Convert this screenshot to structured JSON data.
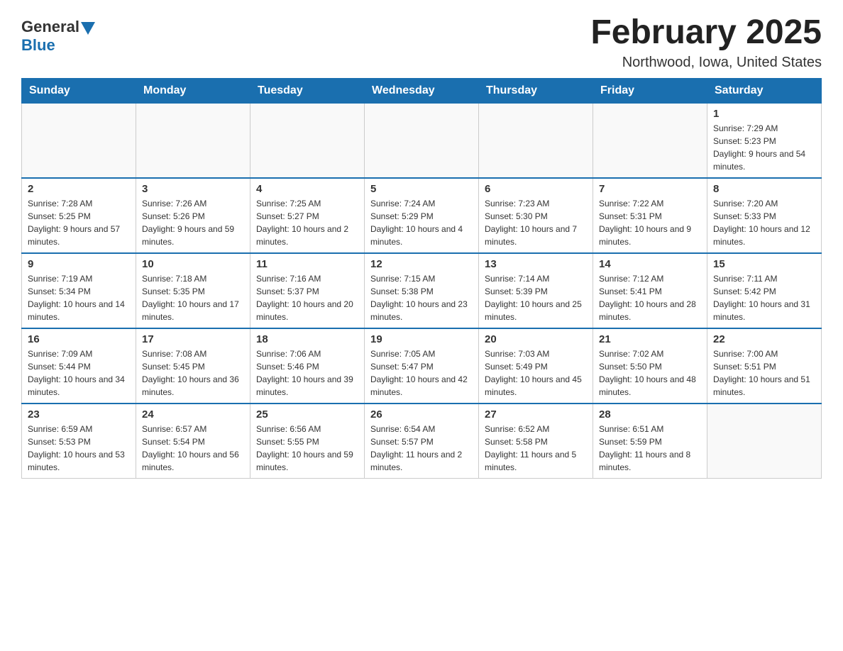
{
  "header": {
    "logo": {
      "text_general": "General",
      "text_blue": "Blue",
      "arrow_icon": "triangle-down-icon"
    },
    "title": "February 2025",
    "location": "Northwood, Iowa, United States"
  },
  "weekdays": [
    "Sunday",
    "Monday",
    "Tuesday",
    "Wednesday",
    "Thursday",
    "Friday",
    "Saturday"
  ],
  "weeks": [
    [
      {
        "day": "",
        "info": ""
      },
      {
        "day": "",
        "info": ""
      },
      {
        "day": "",
        "info": ""
      },
      {
        "day": "",
        "info": ""
      },
      {
        "day": "",
        "info": ""
      },
      {
        "day": "",
        "info": ""
      },
      {
        "day": "1",
        "info": "Sunrise: 7:29 AM\nSunset: 5:23 PM\nDaylight: 9 hours and 54 minutes."
      }
    ],
    [
      {
        "day": "2",
        "info": "Sunrise: 7:28 AM\nSunset: 5:25 PM\nDaylight: 9 hours and 57 minutes."
      },
      {
        "day": "3",
        "info": "Sunrise: 7:26 AM\nSunset: 5:26 PM\nDaylight: 9 hours and 59 minutes."
      },
      {
        "day": "4",
        "info": "Sunrise: 7:25 AM\nSunset: 5:27 PM\nDaylight: 10 hours and 2 minutes."
      },
      {
        "day": "5",
        "info": "Sunrise: 7:24 AM\nSunset: 5:29 PM\nDaylight: 10 hours and 4 minutes."
      },
      {
        "day": "6",
        "info": "Sunrise: 7:23 AM\nSunset: 5:30 PM\nDaylight: 10 hours and 7 minutes."
      },
      {
        "day": "7",
        "info": "Sunrise: 7:22 AM\nSunset: 5:31 PM\nDaylight: 10 hours and 9 minutes."
      },
      {
        "day": "8",
        "info": "Sunrise: 7:20 AM\nSunset: 5:33 PM\nDaylight: 10 hours and 12 minutes."
      }
    ],
    [
      {
        "day": "9",
        "info": "Sunrise: 7:19 AM\nSunset: 5:34 PM\nDaylight: 10 hours and 14 minutes."
      },
      {
        "day": "10",
        "info": "Sunrise: 7:18 AM\nSunset: 5:35 PM\nDaylight: 10 hours and 17 minutes."
      },
      {
        "day": "11",
        "info": "Sunrise: 7:16 AM\nSunset: 5:37 PM\nDaylight: 10 hours and 20 minutes."
      },
      {
        "day": "12",
        "info": "Sunrise: 7:15 AM\nSunset: 5:38 PM\nDaylight: 10 hours and 23 minutes."
      },
      {
        "day": "13",
        "info": "Sunrise: 7:14 AM\nSunset: 5:39 PM\nDaylight: 10 hours and 25 minutes."
      },
      {
        "day": "14",
        "info": "Sunrise: 7:12 AM\nSunset: 5:41 PM\nDaylight: 10 hours and 28 minutes."
      },
      {
        "day": "15",
        "info": "Sunrise: 7:11 AM\nSunset: 5:42 PM\nDaylight: 10 hours and 31 minutes."
      }
    ],
    [
      {
        "day": "16",
        "info": "Sunrise: 7:09 AM\nSunset: 5:44 PM\nDaylight: 10 hours and 34 minutes."
      },
      {
        "day": "17",
        "info": "Sunrise: 7:08 AM\nSunset: 5:45 PM\nDaylight: 10 hours and 36 minutes."
      },
      {
        "day": "18",
        "info": "Sunrise: 7:06 AM\nSunset: 5:46 PM\nDaylight: 10 hours and 39 minutes."
      },
      {
        "day": "19",
        "info": "Sunrise: 7:05 AM\nSunset: 5:47 PM\nDaylight: 10 hours and 42 minutes."
      },
      {
        "day": "20",
        "info": "Sunrise: 7:03 AM\nSunset: 5:49 PM\nDaylight: 10 hours and 45 minutes."
      },
      {
        "day": "21",
        "info": "Sunrise: 7:02 AM\nSunset: 5:50 PM\nDaylight: 10 hours and 48 minutes."
      },
      {
        "day": "22",
        "info": "Sunrise: 7:00 AM\nSunset: 5:51 PM\nDaylight: 10 hours and 51 minutes."
      }
    ],
    [
      {
        "day": "23",
        "info": "Sunrise: 6:59 AM\nSunset: 5:53 PM\nDaylight: 10 hours and 53 minutes."
      },
      {
        "day": "24",
        "info": "Sunrise: 6:57 AM\nSunset: 5:54 PM\nDaylight: 10 hours and 56 minutes."
      },
      {
        "day": "25",
        "info": "Sunrise: 6:56 AM\nSunset: 5:55 PM\nDaylight: 10 hours and 59 minutes."
      },
      {
        "day": "26",
        "info": "Sunrise: 6:54 AM\nSunset: 5:57 PM\nDaylight: 11 hours and 2 minutes."
      },
      {
        "day": "27",
        "info": "Sunrise: 6:52 AM\nSunset: 5:58 PM\nDaylight: 11 hours and 5 minutes."
      },
      {
        "day": "28",
        "info": "Sunrise: 6:51 AM\nSunset: 5:59 PM\nDaylight: 11 hours and 8 minutes."
      },
      {
        "day": "",
        "info": ""
      }
    ]
  ]
}
